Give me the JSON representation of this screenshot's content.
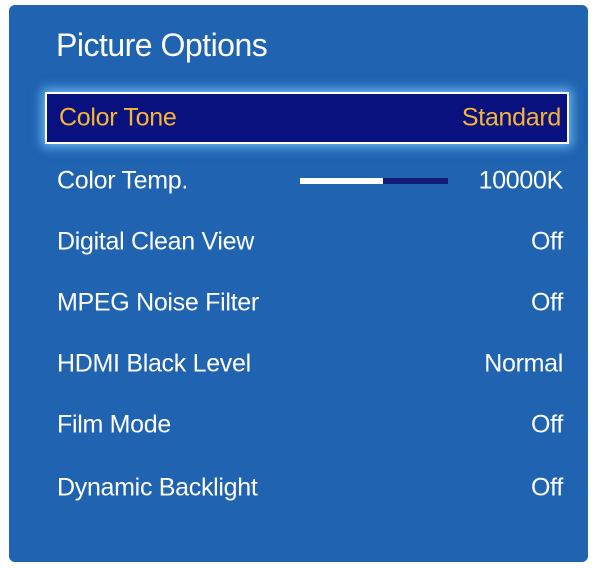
{
  "panel": {
    "title": "Picture Options"
  },
  "items": [
    {
      "label": "Color Tone",
      "value": "Standard"
    },
    {
      "label": "Color Temp.",
      "value": "10000K",
      "slider_level": 0.56
    },
    {
      "label": "Digital Clean View",
      "value": "Off"
    },
    {
      "label": "MPEG Noise Filter",
      "value": "Off"
    },
    {
      "label": "HDMI Black Level",
      "value": "Normal"
    },
    {
      "label": "Film Mode",
      "value": "Off"
    },
    {
      "label": "Dynamic Backlight",
      "value": "Off"
    }
  ],
  "colors": {
    "panel_bg": "#1f63b1",
    "selected_bg": "#08117e",
    "selected_text": "#f7b437",
    "text": "#ffffff"
  }
}
